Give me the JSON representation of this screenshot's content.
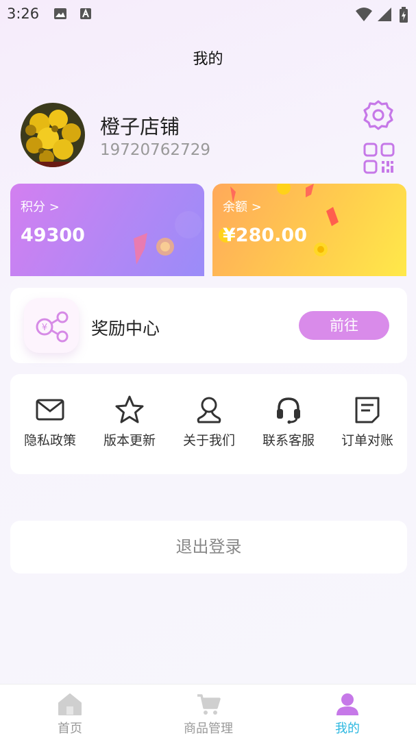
{
  "status": {
    "time": "3:26"
  },
  "header": {
    "title": "我的"
  },
  "profile": {
    "name": "橙子店铺",
    "phone": "19720762729"
  },
  "cards": {
    "points": {
      "label": "积分 >",
      "value": "49300"
    },
    "balance": {
      "label": "余额 >",
      "value": "¥280.00"
    }
  },
  "reward": {
    "title": "奖励中心",
    "button": "前往",
    "icon_symbol": "¥"
  },
  "menu": [
    {
      "label": "隐私政策",
      "icon": "mail-icon"
    },
    {
      "label": "版本更新",
      "icon": "star-icon"
    },
    {
      "label": "关于我们",
      "icon": "person-icon"
    },
    {
      "label": "联系客服",
      "icon": "headset-icon"
    },
    {
      "label": "订单对账",
      "icon": "document-icon"
    }
  ],
  "logout": {
    "label": "退出登录"
  },
  "tabbar": [
    {
      "label": "首页",
      "icon": "home-icon",
      "active": false
    },
    {
      "label": "商品管理",
      "icon": "cart-icon",
      "active": false
    },
    {
      "label": "我的",
      "icon": "user-icon",
      "active": true
    }
  ],
  "colors": {
    "accent": "#d98bea",
    "tab_active": "#2bb7e0",
    "icon_purple": "#c678e8"
  }
}
